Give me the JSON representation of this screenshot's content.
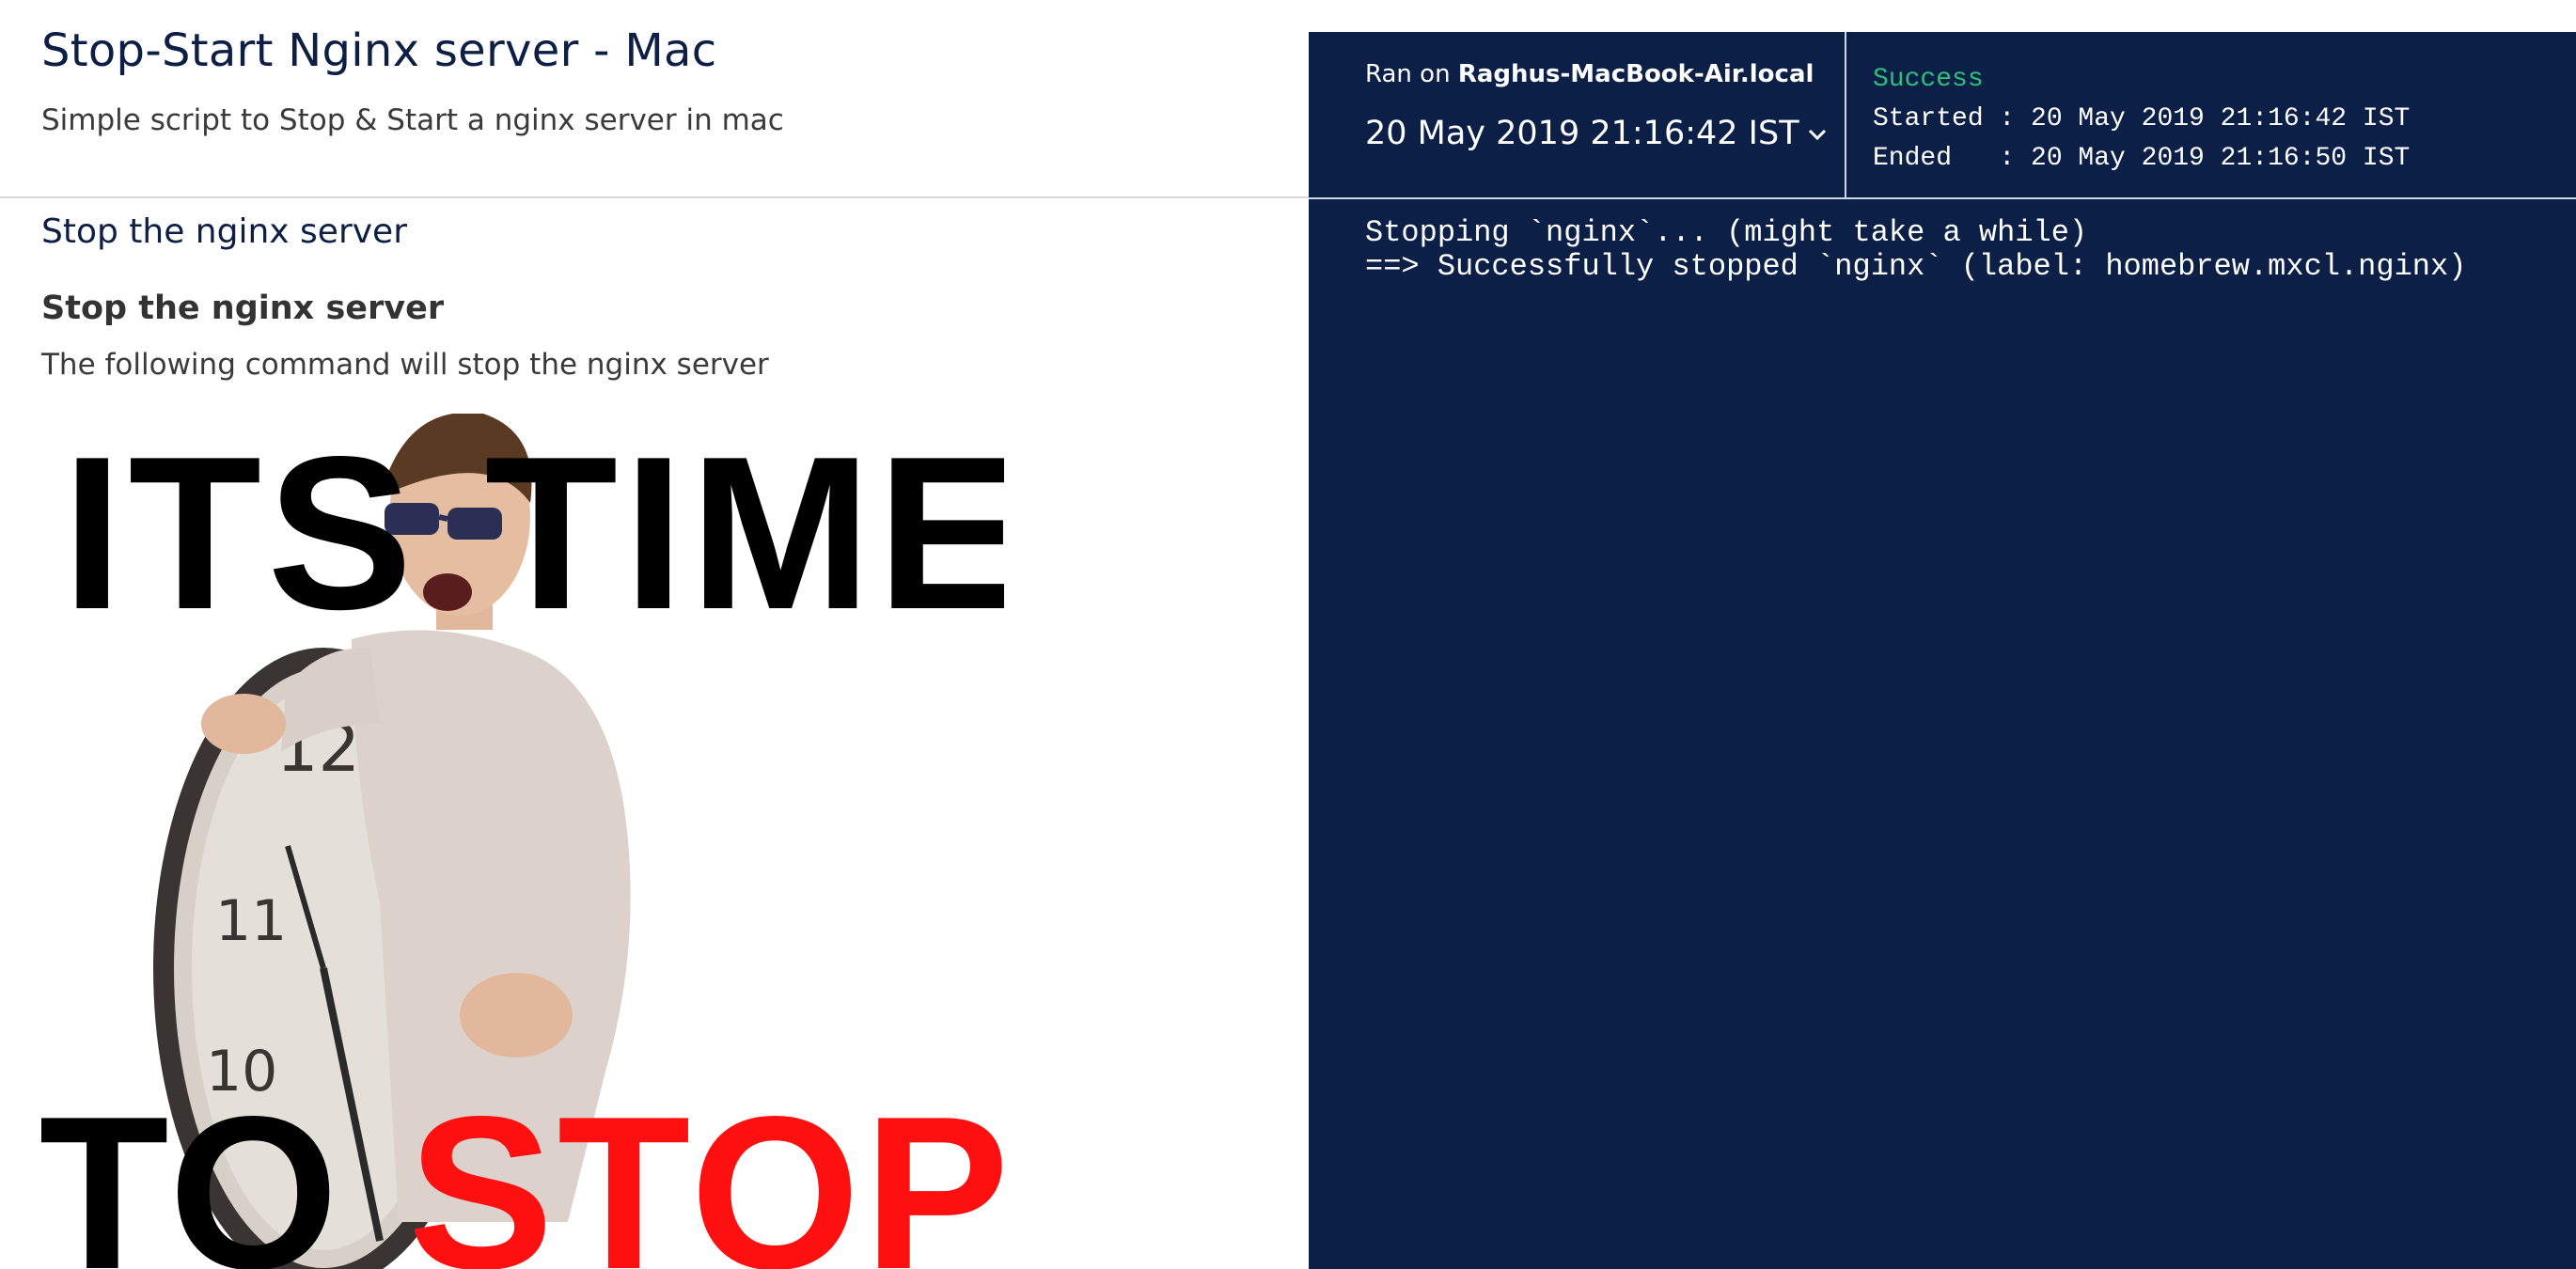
{
  "page": {
    "title": "Stop-Start Nginx server - Mac",
    "description": "Simple script to Stop & Start a nginx server in mac"
  },
  "step": {
    "title": "Stop the nginx server",
    "heading": "Stop the nginx server",
    "text": "The following command will stop the nginx server"
  },
  "meme": {
    "top_text": "ITS TIME",
    "bottom_text_1": "TO",
    "bottom_text_2": "STOP",
    "stop_color": "#ff1010"
  },
  "run": {
    "ran_on_prefix": "Ran on",
    "host": "Raghus-MacBook-Air.local",
    "date": "20 May 2019 21:16:42 IST",
    "status": "Success",
    "started": "Started : 20 May 2019 21:16:42 IST",
    "ended": "Ended   : 20 May 2019 21:16:50 IST",
    "output_lines": [
      "Stopping `nginx`... (might take a while)",
      "==> Successfully stopped `nginx` (label: homebrew.mxcl.nginx)"
    ]
  },
  "colors": {
    "panel_bg": "#0c1f47",
    "success": "#2ec07a",
    "title": "#0d1f45"
  },
  "icons": {
    "date_dropdown": "chevron-down-icon"
  }
}
